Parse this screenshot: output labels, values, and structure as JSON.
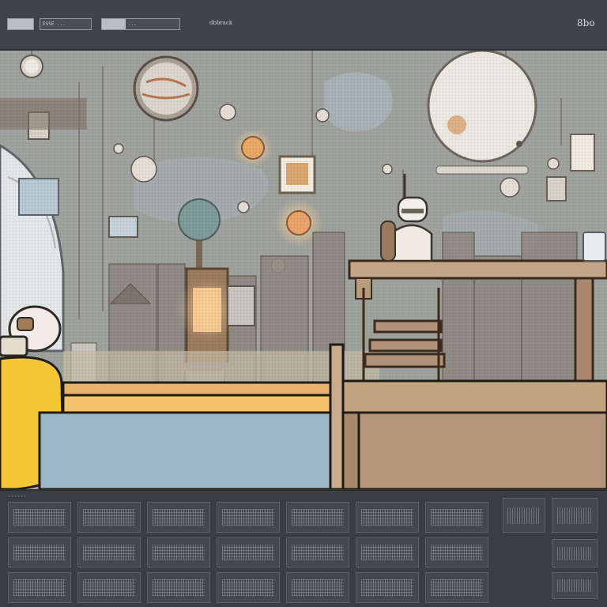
{
  "toolbar": {
    "field1_text": "ESSE ...",
    "field2_text": "...",
    "document_label": "dbbrack",
    "frame_counter": "8bo"
  },
  "timeline": {
    "tab_label": "::::::",
    "frames": [
      {
        "label": ""
      },
      {
        "label": ""
      },
      {
        "label": ""
      },
      {
        "label": ""
      },
      {
        "label": ""
      },
      {
        "label": ""
      },
      {
        "label": ""
      },
      {
        "label": ""
      },
      {
        "label": ""
      },
      {
        "label": ""
      },
      {
        "label": ""
      },
      {
        "label": ""
      },
      {
        "label": ""
      },
      {
        "label": ""
      },
      {
        "label": ""
      },
      {
        "label": ""
      },
      {
        "label": ""
      },
      {
        "label": ""
      },
      {
        "label": ""
      },
      {
        "label": ""
      },
      {
        "label": ""
      }
    ]
  },
  "scene": {
    "palette": {
      "wall": "#9ea09b",
      "wall_light": "#b7bab4",
      "yellow": "#f4c534",
      "blue_floor": "#9bb7c7",
      "wood": "#b5977a",
      "wood_dark": "#7d5e45",
      "table": "#c7ab8a",
      "orange_floor": "#e9b76b",
      "lamp": "#f3c48f"
    },
    "icons": [
      "clock-icon",
      "globe-icon",
      "lamp-globe-icon",
      "robot-figure-icon",
      "pawn-character-icon",
      "tree-icon",
      "picture-frame-icon",
      "sun-lamp-icon"
    ]
  }
}
